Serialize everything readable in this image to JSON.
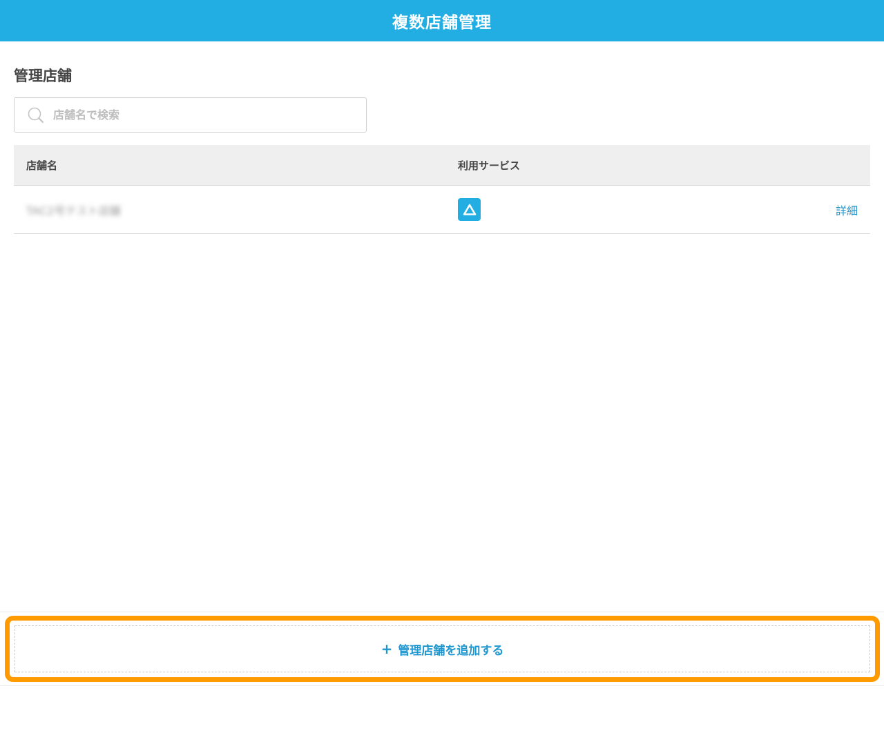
{
  "header": {
    "title": "複数店舗管理"
  },
  "section": {
    "title": "管理店舗"
  },
  "search": {
    "placeholder": "店舗名で検索",
    "icon": "search-icon"
  },
  "table": {
    "columns": {
      "name": "店舗名",
      "service": "利用サービス"
    },
    "rows": [
      {
        "name": "TAC2号テスト店舗",
        "service_icon": "triangle-logo-icon",
        "detail_label": "詳細"
      }
    ]
  },
  "footer": {
    "add_button_label": "管理店舗を追加する",
    "plus": "+"
  },
  "colors": {
    "brand": "#22ade3",
    "link": "#1e96cf",
    "highlight": "#ff9a00"
  }
}
